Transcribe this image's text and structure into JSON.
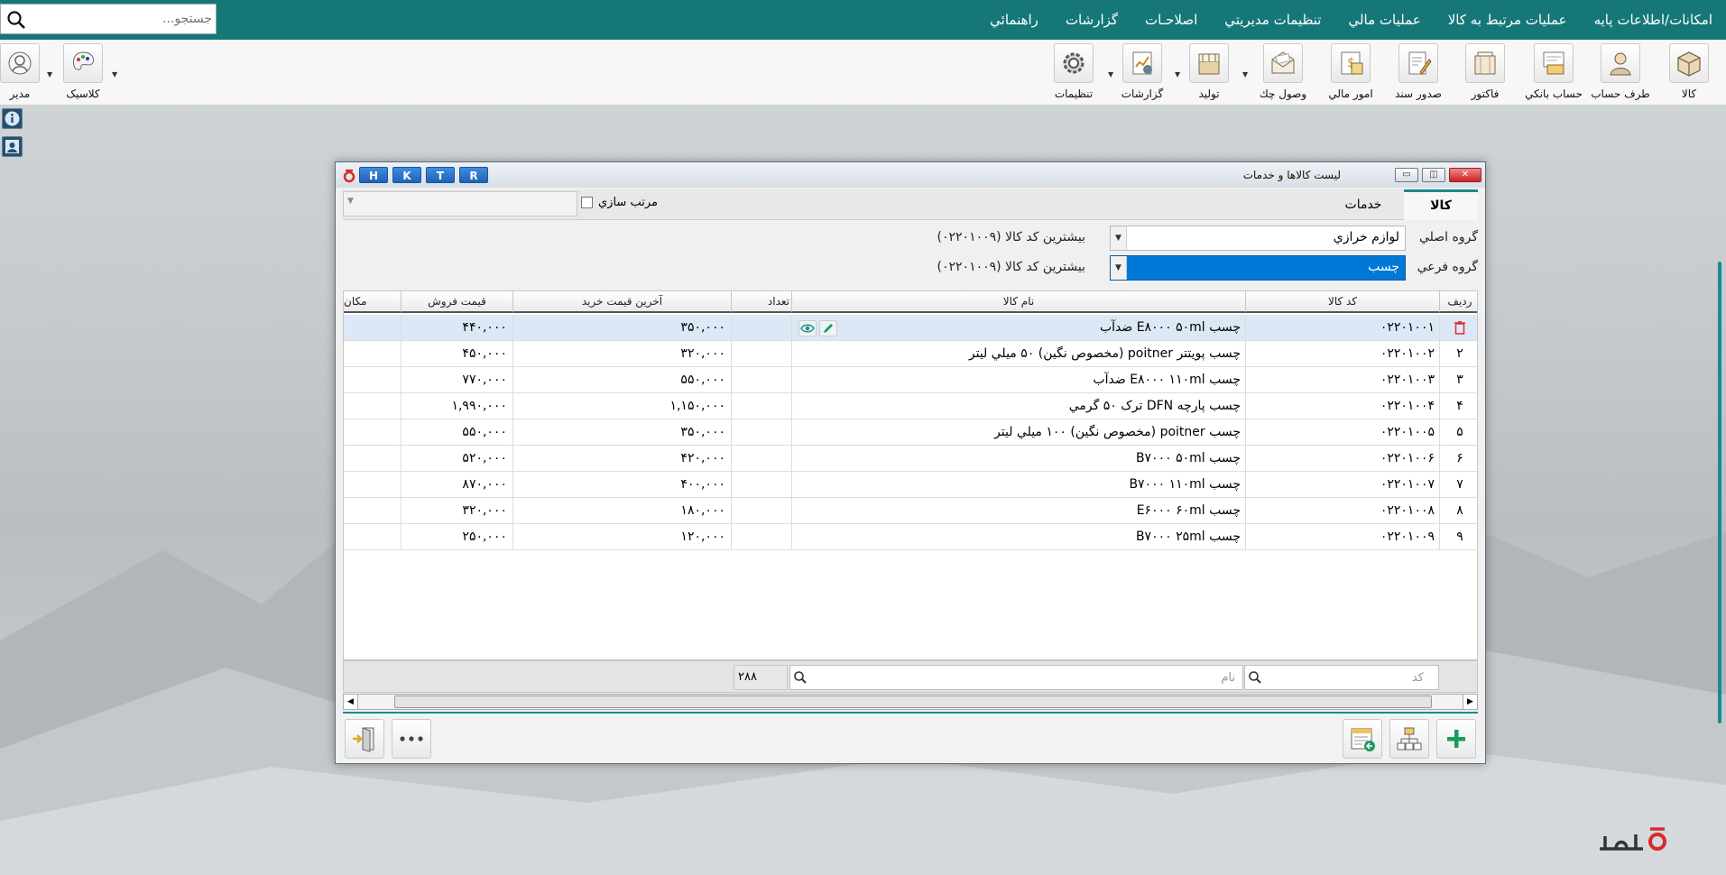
{
  "search": {
    "placeholder": "جستجو..."
  },
  "menu": [
    "امکانات/اطلاعات پایه",
    "عملیات مرتبط به کالا",
    "عملیات مالي",
    "تنظیمات مدیریتي",
    "اصلاحـات",
    "گزارشات",
    "راهنمائي"
  ],
  "toolbar": {
    "items": [
      {
        "label": "کالا",
        "icon": "box-icon"
      },
      {
        "label": "طرف حساب",
        "icon": "person-icon"
      },
      {
        "label": "حساب بانکي",
        "icon": "bank-card-icon"
      },
      {
        "label": "فاکتور",
        "icon": "cart-icon"
      },
      {
        "label": "صدور سند",
        "icon": "document-pen-icon"
      },
      {
        "label": "امور مالي",
        "icon": "money-icon"
      },
      {
        "label": "وصول چك",
        "icon": "envelope-check-icon"
      },
      {
        "label": "تولید",
        "icon": "factory-icon"
      },
      {
        "label": "گزارشات",
        "icon": "report-chart-icon"
      },
      {
        "label": "تنظیمات",
        "icon": "gear-icon"
      }
    ],
    "left": [
      {
        "label": "کلاسیک",
        "icon": "palette-icon"
      },
      {
        "label": "مدیر",
        "icon": "user-avatar-icon"
      }
    ]
  },
  "window": {
    "title": "ليست كالاها و خدمات",
    "buttons": [
      "H",
      "K",
      "T",
      "R"
    ]
  },
  "tabs": {
    "goods": "کالا",
    "services": "خدمات",
    "sort_label": "مرتب سازي"
  },
  "form": {
    "main_group_label": "گروه اصلي",
    "main_group_value": "لوازم خرازي",
    "main_group_info": "بیشترین کد کالا (۰۲۲۰۱۰۰۹)",
    "sub_group_label": "گروه فرعي",
    "sub_group_value": "چسب",
    "sub_group_info": "بیشترین کد کالا (۰۲۲۰۱۰۰۹)"
  },
  "grid": {
    "headers": {
      "row": "رديف",
      "code": "کد کالا",
      "name": "نام کالا",
      "qty": "تعداد",
      "last_buy": "آخرين قيمت خريد",
      "sell": "قیمت فروش",
      "loc": "مکان"
    },
    "rows": [
      {
        "row": "",
        "code": "۰۲۲۰۱۰۰۱",
        "name": "چسب E۸۰۰۰ ۵۰ml ضدآب",
        "last_buy": "۳۵۰,۰۰۰",
        "sell": "۴۴۰,۰۰۰"
      },
      {
        "row": "۲",
        "code": "۰۲۲۰۱۰۰۲",
        "name": "چسب پویتتر poitner (مخصوص نگین) ۵۰ ميلي ليتر",
        "last_buy": "۳۲۰,۰۰۰",
        "sell": "۴۵۰,۰۰۰"
      },
      {
        "row": "۳",
        "code": "۰۲۲۰۱۰۰۳",
        "name": "چسب E۸۰۰۰ ۱۱۰ml ضدآب",
        "last_buy": "۵۵۰,۰۰۰",
        "sell": "۷۷۰,۰۰۰"
      },
      {
        "row": "۴",
        "code": "۰۲۲۰۱۰۰۴",
        "name": "چسب پارچه DFN ترک ۵۰ گرمي",
        "last_buy": "۱,۱۵۰,۰۰۰",
        "sell": "۱,۹۹۰,۰۰۰"
      },
      {
        "row": "۵",
        "code": "۰۲۲۰۱۰۰۵",
        "name": "چسب poitner (مخصوص نگین) ۱۰۰ ميلي ليتر",
        "last_buy": "۳۵۰,۰۰۰",
        "sell": "۵۵۰,۰۰۰"
      },
      {
        "row": "۶",
        "code": "۰۲۲۰۱۰۰۶",
        "name": "چسب B۷۰۰۰ ۵۰ml",
        "last_buy": "۴۲۰,۰۰۰",
        "sell": "۵۲۰,۰۰۰"
      },
      {
        "row": "۷",
        "code": "۰۲۲۰۱۰۰۷",
        "name": "چسب B۷۰۰۰ ۱۱۰ml",
        "last_buy": "۴۰۰,۰۰۰",
        "sell": "۸۷۰,۰۰۰"
      },
      {
        "row": "۸",
        "code": "۰۲۲۰۱۰۰۸",
        "name": "چسب E۶۰۰۰ ۶۰ml",
        "last_buy": "۱۸۰,۰۰۰",
        "sell": "۳۲۰,۰۰۰"
      },
      {
        "row": "۹",
        "code": "۰۲۲۰۱۰۰۹",
        "name": "چسب B۷۰۰۰ ۲۵ml",
        "last_buy": "۱۲۰,۰۰۰",
        "sell": "۲۵۰,۰۰۰"
      }
    ]
  },
  "footer": {
    "code_placeholder": "کد",
    "name_placeholder": "نام",
    "total": "۲۸۸"
  },
  "colors": {
    "accent": "#157778",
    "selected": "#0078d7"
  }
}
